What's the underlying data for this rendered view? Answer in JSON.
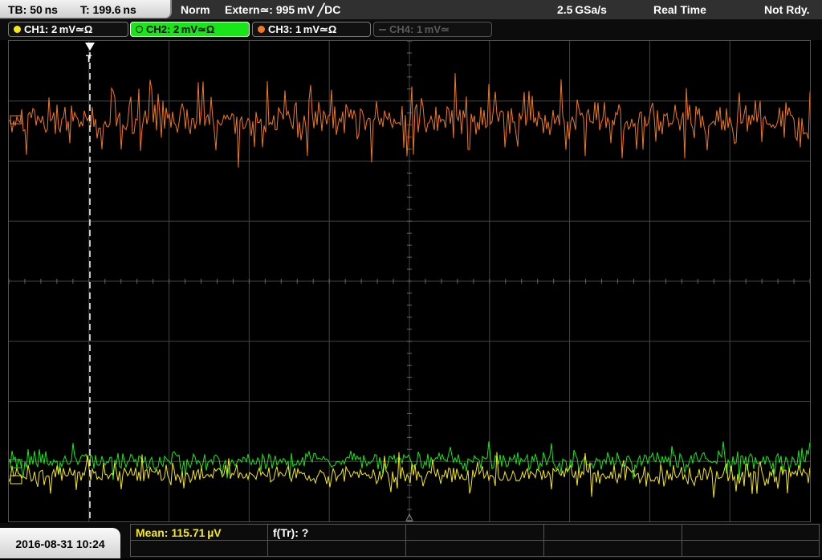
{
  "top_bar": {
    "timebase": "TB: 50 ns",
    "trigger_time": "T: 199.6 ns",
    "trigger_mode": "Norm",
    "trigger_source": "Extern≃: 995 mV ╱DC",
    "sample_rate": "2.5 GSa/s",
    "acquisition": "Real Time",
    "status": "Not Rdy."
  },
  "channels": [
    {
      "label": "CH1: 2 mV≃Ω",
      "color": "#f5ea14",
      "active": true
    },
    {
      "label": "CH2: 2 mV≃Ω",
      "color": "#19e619",
      "active": true,
      "selected": true
    },
    {
      "label": "CH3: 1 mV≃Ω",
      "color": "#f07820",
      "active": true
    },
    {
      "label": "CH4: 1 mV≃",
      "color": "#555555",
      "active": false
    }
  ],
  "trigger_marker": "T",
  "bottom_bar": {
    "datetime": "2016-08-31 10:24",
    "measurement_1": "Mean: 115.71 µV",
    "measurement_2": "f(Tr): ?"
  },
  "colors": {
    "ch1": "#f5ea14",
    "ch2": "#19e619",
    "ch3": "#f07820",
    "grid": "#444444",
    "trigger_line": "#ffffff"
  }
}
